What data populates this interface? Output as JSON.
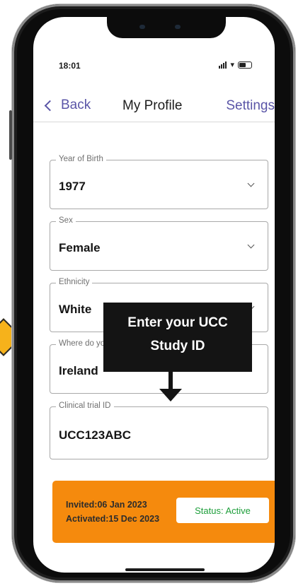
{
  "status_bar": {
    "time": "18:01"
  },
  "nav": {
    "back_label": "Back",
    "title": "My Profile",
    "settings_label": "Settings"
  },
  "fields": [
    {
      "label": "Year of Birth",
      "value": "1977"
    },
    {
      "label": "Sex",
      "value": "Female"
    },
    {
      "label": "Ethnicity",
      "value": "White"
    },
    {
      "label": "Where do you live?",
      "value": "Ireland"
    },
    {
      "label": "Clinical trial ID",
      "value": "UCC123ABC"
    }
  ],
  "callout": {
    "line1": "Enter your UCC",
    "line2": "Study ID"
  },
  "status_card": {
    "invited": "Invited:06 Jan 2023",
    "activated": "Activated:15 Dec 2023",
    "status": "Status: Active"
  },
  "colors": {
    "accent": "#5a55a7",
    "card": "#f58a0d",
    "status_green": "#1d9e3a",
    "callout_bg": "#141414",
    "arrow": "#f6b21b"
  }
}
